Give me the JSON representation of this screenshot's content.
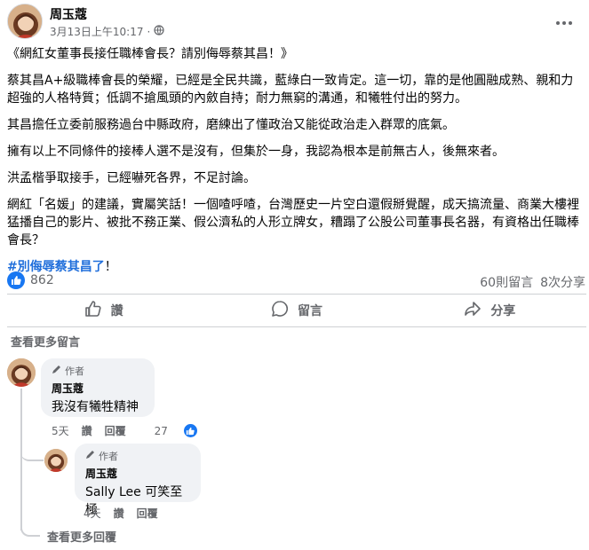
{
  "post": {
    "author": "周玉蔻",
    "time": "3月13日上午10:17",
    "audience_separator": "·",
    "paragraphs": [
      "《網紅女董事長接任職棒會長？請別侮辱蔡其昌！》",
      "蔡其昌A+級職棒會長的榮耀，已經是全民共識，藍綠白一致肯定。這一切，靠的是他圓融成熟、親和力超強的人格特質；低調不搶風頭的內斂自持；耐力無窮的溝通，和犧牲付出的努力。",
      "其昌擔任立委前服務過台中縣政府，磨練出了懂政治又能從政治走入群眾的底氣。",
      "擁有以上不同條件的接棒人選不是沒有，但集於一身，我認為根本是前無古人，後無來者。",
      "洪孟楷爭取接手，已經嚇死各界，不足討論。",
      "網紅「名媛」的建議，實屬笑話！一個喳呼喳，台灣歷史一片空白還假掰覺醒，成天搞流量、商業大樓裡猛播自己的影片、被批不務正業、假公濟私的人形立牌女，糟蹋了公股公司董事長名器，有資格出任職棒會長？"
    ],
    "hashtag": "#別侮辱蔡其昌了",
    "hashtag_suffix": "！"
  },
  "stats": {
    "reaction_count": "862",
    "comments": "60則留言",
    "shares": "8次分享"
  },
  "actions": {
    "like": "讚",
    "comment": "留言",
    "share": "分享"
  },
  "view_more_comments": "查看更多留言",
  "comments": [
    {
      "badge": "作者",
      "author": "周玉蔻",
      "text": "我沒有犧牲精神",
      "age": "5天",
      "like": "讚",
      "reply": "回覆",
      "like_count": "27"
    },
    {
      "badge": "作者",
      "author": "周玉蔻",
      "text": "Sally Lee 可笑至極",
      "age": "4天",
      "like": "讚",
      "reply": "回覆"
    }
  ],
  "view_more_replies": "查看更多回覆",
  "icons": {
    "avatar": "avatar-portrait",
    "more": "ellipsis-icon",
    "audience": "globe-icon",
    "like": "thumbs-up-icon",
    "comment": "speech-bubble-icon",
    "share": "share-arrow-icon",
    "author_badge": "pencil-icon"
  },
  "colors": {
    "accent": "#1877f2",
    "hashtag": "#216fdb",
    "secondary_text": "#65676b",
    "bubble": "#f0f2f5"
  }
}
